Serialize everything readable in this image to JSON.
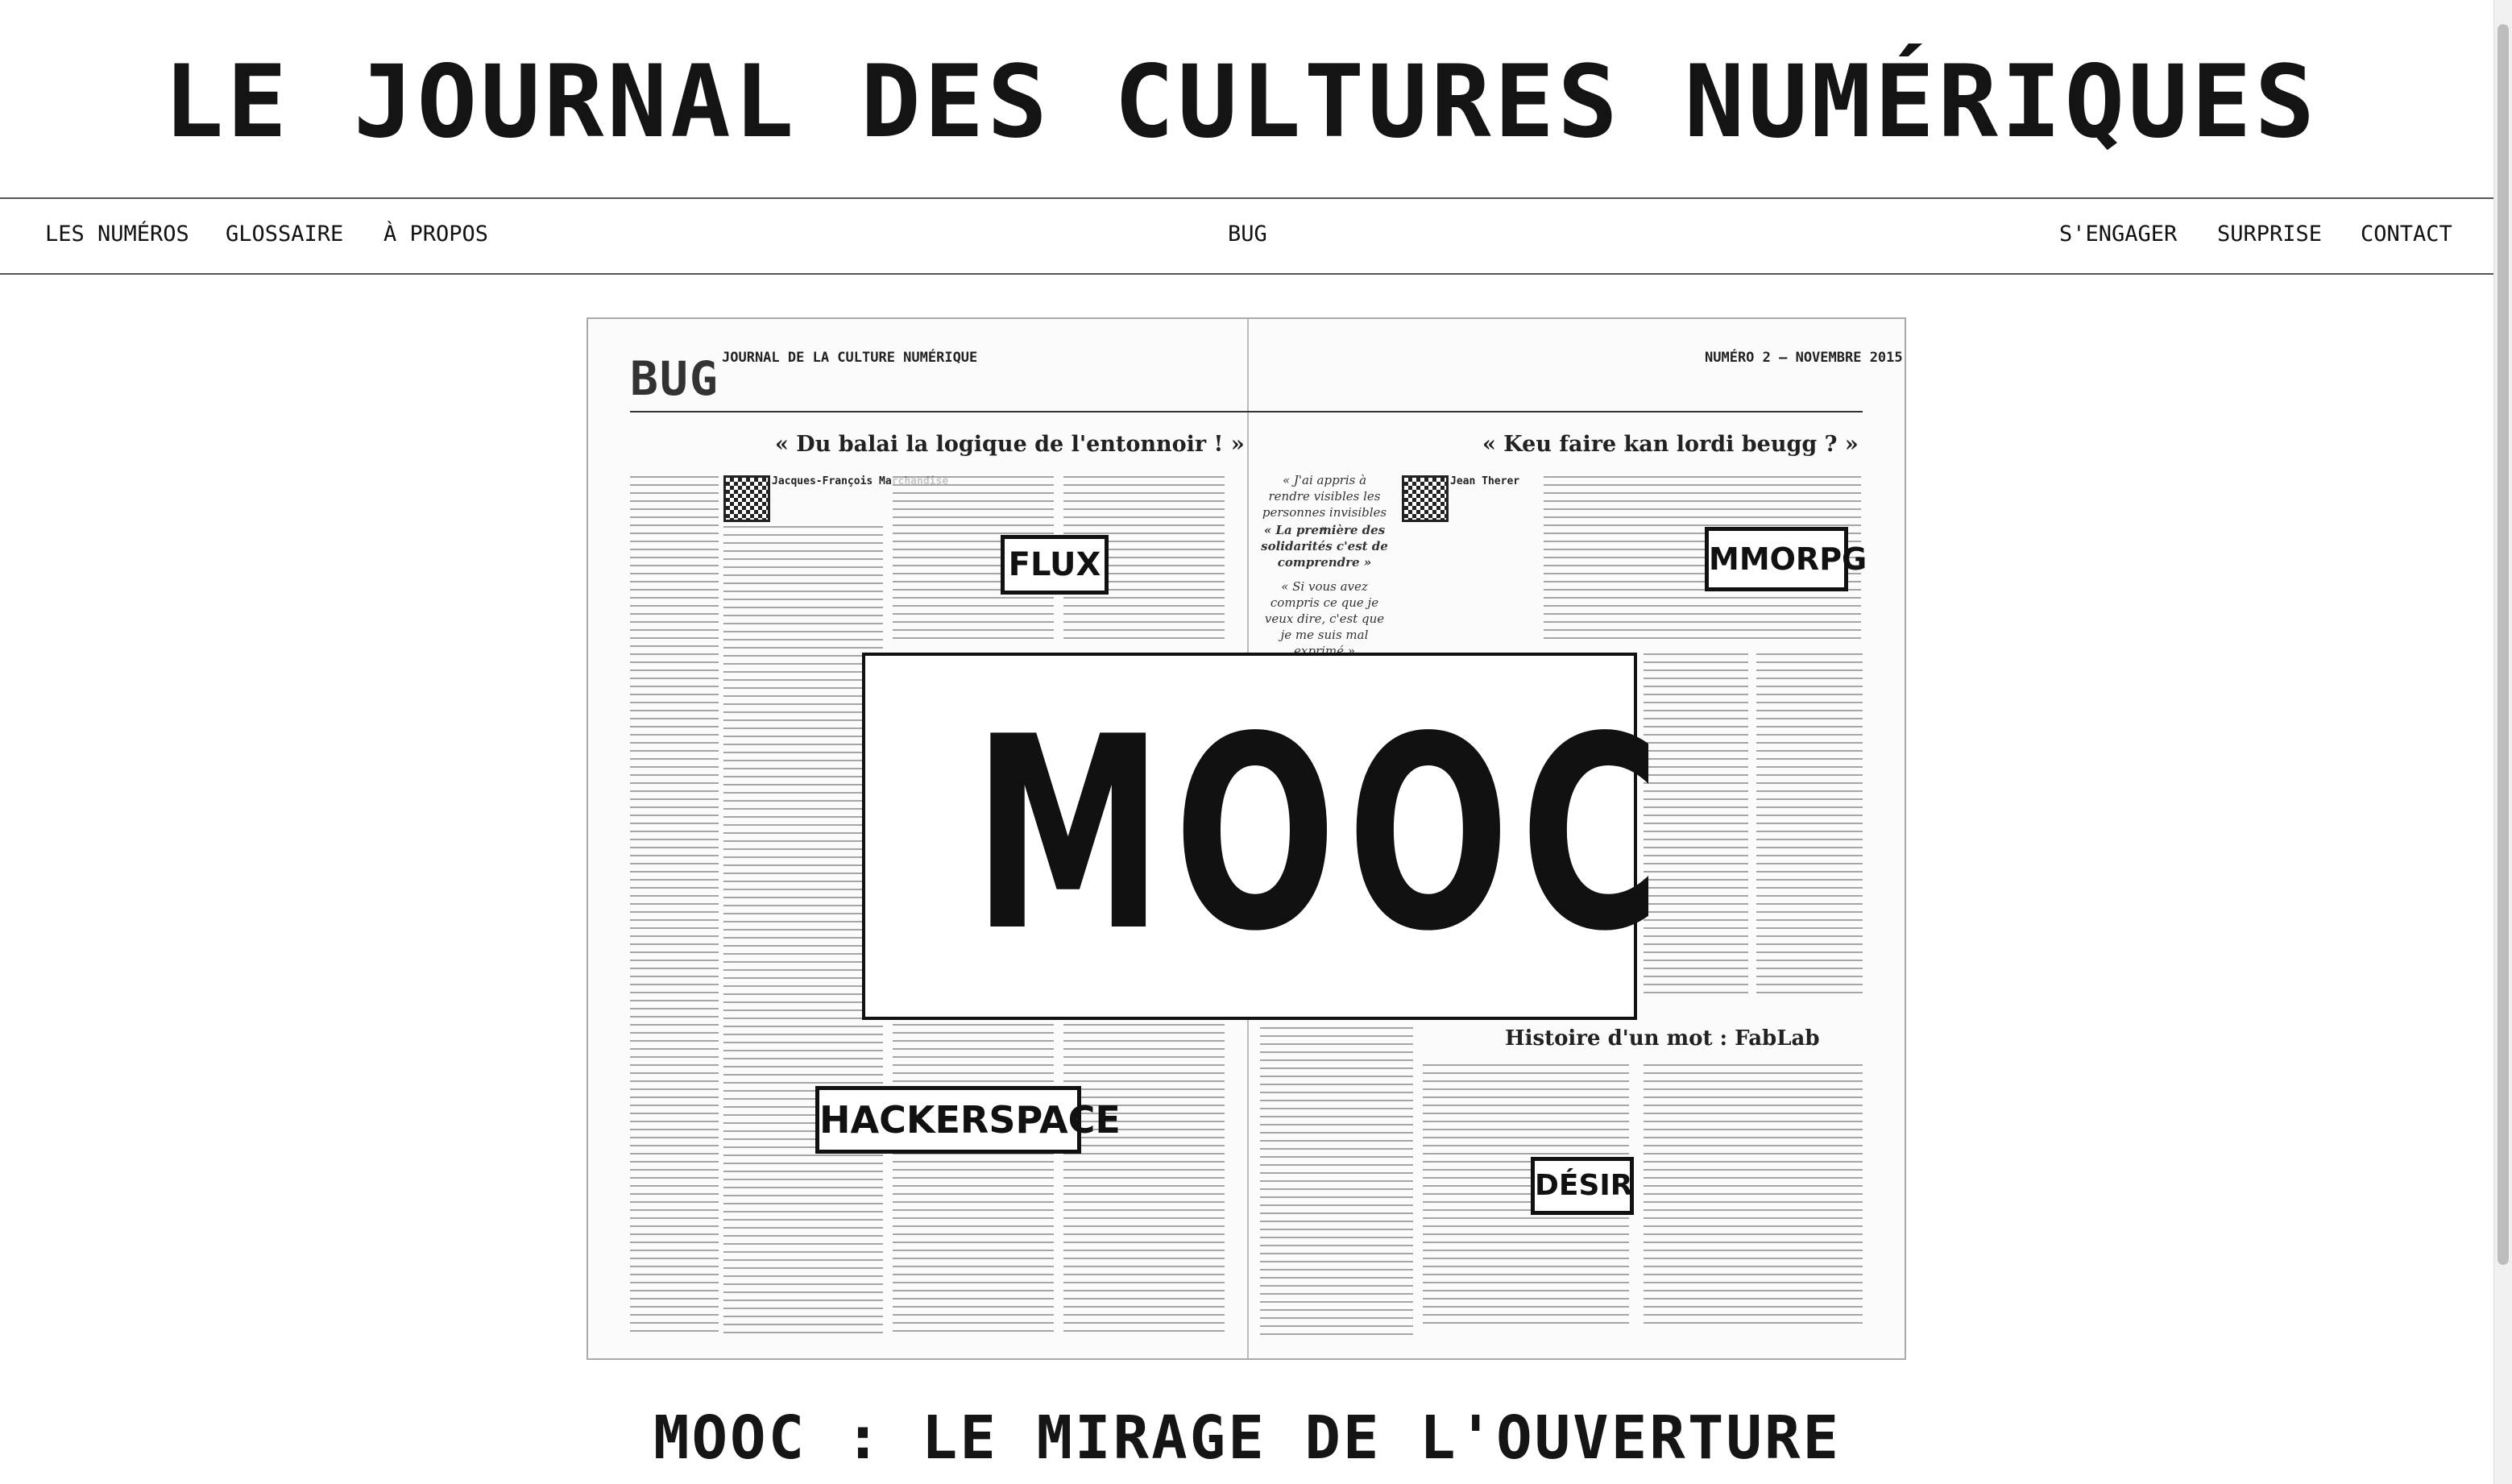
{
  "site": {
    "title": "LE JOURNAL DES CULTURES NUMÉRIQUES"
  },
  "nav": {
    "left": [
      "LES NUMÉROS",
      "GLOSSAIRE",
      "À PROPOS"
    ],
    "center": "BUG",
    "right": [
      "S'ENGAGER",
      "SURPRISE",
      "CONTACT"
    ]
  },
  "cover": {
    "logo": "BUG",
    "journal_label": "JOURNAL DE LA CULTURE NUMÉRIQUE",
    "issue": "NUMÉRO 2 – NOVEMBRE 2015",
    "headline_left": "« Du balai la logique de l'entonnoir ! »",
    "headline_right": "« Keu faire kan lordi beugg ? »",
    "quote_1": "« J'ai appris à rendre visibles les personnes invisibles »",
    "quote_2": "« La première des solidarités c'est de comprendre »",
    "quote_3": "« Si vous avez compris ce que je veux dire, c'est que je me suis mal exprimé »",
    "author_left": "Jacques-François Marchandise",
    "author_right": "Jean Therer",
    "labels": [
      "FLUX",
      "MMORPG",
      "HACKERSPACE",
      "DÉSIR"
    ],
    "main_word": "MOOC",
    "section_title": "Histoire d'un mot : FabLab"
  },
  "article": {
    "title": "MOOC : LE MIRAGE DE L'OUVERTURE"
  }
}
